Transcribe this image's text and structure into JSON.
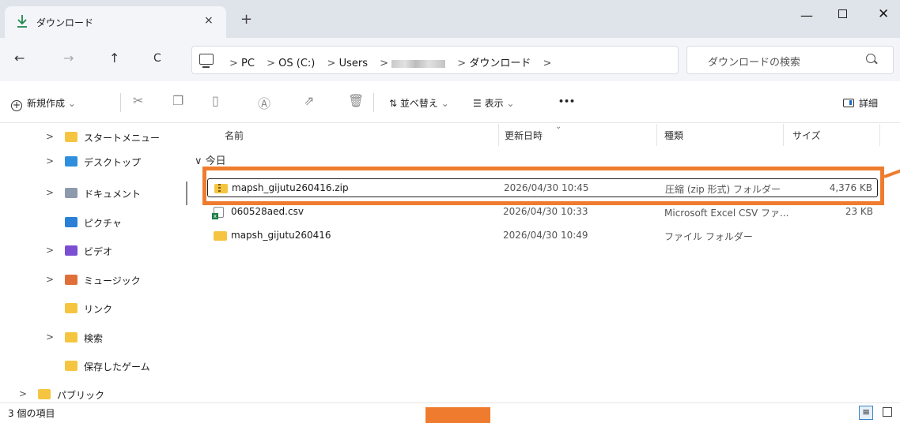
{
  "window": {
    "tab_title": "ダウンロード",
    "tab_close": "×",
    "new_tab": "+",
    "minimize": "—",
    "close": "✕"
  },
  "nav": {
    "back": "←",
    "forward": "→",
    "up": "↑",
    "refresh": "C",
    "breadcrumbs": [
      "PC",
      "OS (C:)",
      "Users",
      "ダウンロード"
    ],
    "separator": ">",
    "search_placeholder": "ダウンロードの検索"
  },
  "commands": {
    "new": "新規作成",
    "sort": "並べ替え",
    "view": "表示",
    "more": "•••",
    "details": "詳細",
    "dropdown": "⌄"
  },
  "sidebar": {
    "items": [
      {
        "label": "スタートメニュー",
        "chevron": ">",
        "icon": "start-menu-folder-icon",
        "color": "#f5c542"
      },
      {
        "label": "デスクトップ",
        "chevron": ">",
        "icon": "desktop-icon",
        "color": "#2f8fdc"
      },
      {
        "label": "ドキュメント",
        "chevron": ">",
        "icon": "documents-icon",
        "color": "#8c9aac"
      },
      {
        "label": "ピクチャ",
        "chevron": "",
        "icon": "pictures-icon",
        "color": "#2a7fd6"
      },
      {
        "label": "ビデオ",
        "chevron": ">",
        "icon": "videos-icon",
        "color": "#7b4fd1"
      },
      {
        "label": "ミュージック",
        "chevron": ">",
        "icon": "music-icon",
        "color": "#e0703a"
      },
      {
        "label": "リンク",
        "chevron": "",
        "icon": "links-folder-icon",
        "color": "#f5c542"
      },
      {
        "label": "検索",
        "chevron": ">",
        "icon": "searches-folder-icon",
        "color": "#f5c542"
      },
      {
        "label": "保存したゲーム",
        "chevron": "",
        "icon": "saved-games-folder-icon",
        "color": "#f5c542"
      },
      {
        "label": "パブリック",
        "chevron": ">",
        "icon": "public-folder-icon",
        "color": "#f5c542"
      }
    ]
  },
  "columns": {
    "name": "名前",
    "modified": "更新日時",
    "type": "種類",
    "size": "サイズ"
  },
  "group_label": "∨ 今日",
  "files": [
    {
      "name": "mapsh_gijutu260416.zip",
      "date": "2026/04/30 10:45",
      "type": "圧縮 (zip 形式) フォルダー",
      "size": "4,376 KB",
      "icon": "zip-folder-icon"
    },
    {
      "name": "060528aed.csv",
      "date": "2026/04/30 10:33",
      "type": "Microsoft Excel CSV ファ...",
      "size": "23 KB",
      "icon": "csv-file-icon"
    },
    {
      "name": "mapsh_gijutu260416",
      "date": "2026/04/30 10:49",
      "type": "ファイル フォルダー",
      "size": "",
      "icon": "folder-icon"
    }
  ],
  "status": {
    "item_count": "3 個の項目",
    "list_view": "≡"
  },
  "colors": {
    "highlight": "#ef7c2e",
    "folder": "#f5c542",
    "titlebar": "#dfe3ea"
  }
}
